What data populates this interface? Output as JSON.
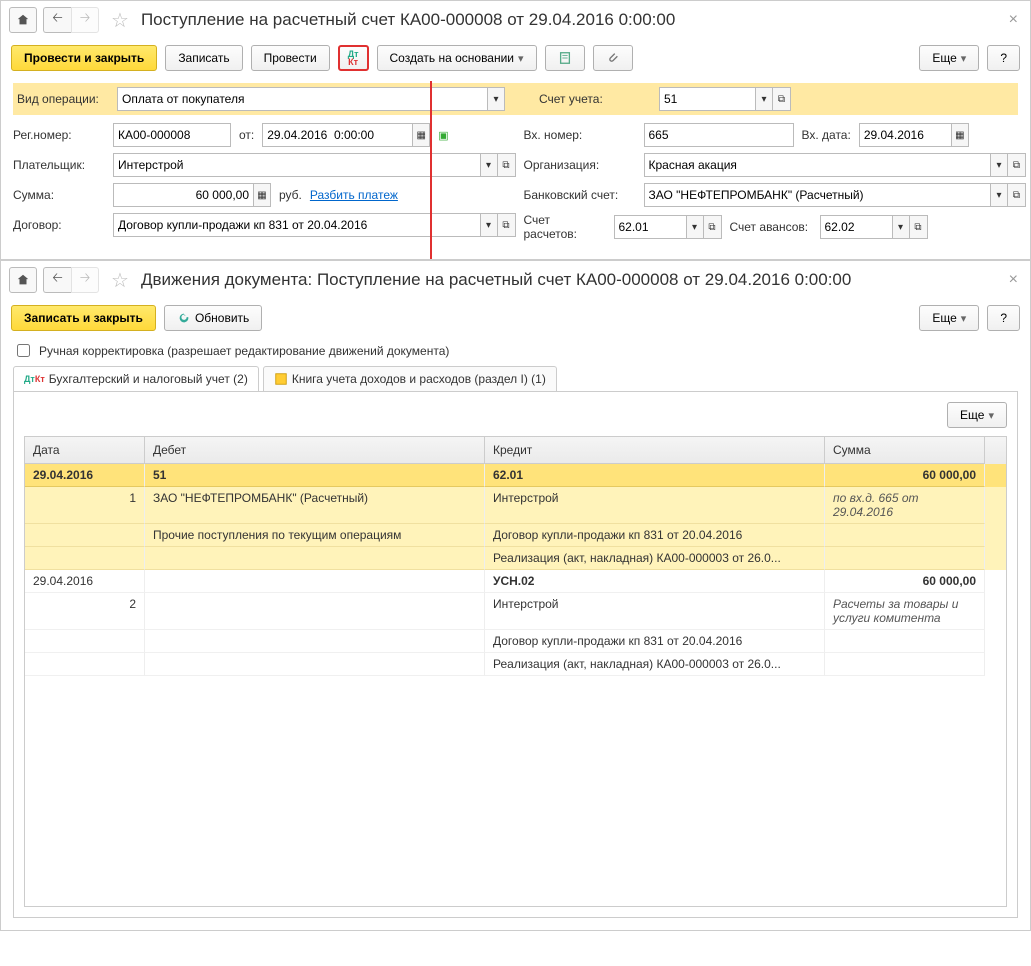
{
  "pane1": {
    "title": "Поступление на расчетный счет КА00-000008 от 29.04.2016 0:00:00",
    "toolbar": {
      "post_close": "Провести и закрыть",
      "save": "Записать",
      "post": "Провести",
      "create_based": "Создать на основании",
      "more": "Еще",
      "help": "?"
    },
    "form": {
      "op_type_label": "Вид операции:",
      "op_type_value": "Оплата от покупателя",
      "account_label": "Счет учета:",
      "account_value": "51",
      "reg_num_label": "Рег.номер:",
      "reg_num_value": "КА00-000008",
      "from_label": "от:",
      "from_value": "29.04.2016  0:00:00",
      "in_num_label": "Вх. номер:",
      "in_num_value": "665",
      "in_date_label": "Вх. дата:",
      "in_date_value": "29.04.2016",
      "payer_label": "Плательщик:",
      "payer_value": "Интерстрой",
      "org_label": "Организация:",
      "org_value": "Красная акация",
      "sum_label": "Сумма:",
      "sum_value": "60 000,00",
      "currency": "руб.",
      "split_link": "Разбить платеж",
      "bank_acc_label": "Банковский счет:",
      "bank_acc_value": "ЗАО \"НЕФТЕПРОМБАНК\" (Расчетный)",
      "contract_label": "Договор:",
      "contract_value": "Договор купли-продажи кп 831 от 20.04.2016",
      "settle_acc_label": "Счет расчетов:",
      "settle_acc_value": "62.01",
      "advance_acc_label": "Счет авансов:",
      "advance_acc_value": "62.02"
    }
  },
  "pane2": {
    "title": "Движения документа: Поступление на расчетный счет КА00-000008 от 29.04.2016 0:00:00",
    "toolbar": {
      "save_close": "Записать и закрыть",
      "refresh": "Обновить",
      "more": "Еще",
      "help": "?"
    },
    "manual_edit_label": "Ручная корректировка (разрешает редактирование движений документа)",
    "tabs": {
      "tab1": "Бухгалтерский и налоговый учет (2)",
      "tab2": "Книга учета доходов и расходов (раздел I) (1)"
    },
    "grid_more": "Еще",
    "columns": {
      "date": "Дата",
      "debit": "Дебет",
      "credit": "Кредит",
      "sum": "Сумма"
    },
    "rows": [
      {
        "date": "29.04.2016",
        "debit_acc": "51",
        "credit_acc": "62.01",
        "sum": "60 000,00",
        "n": "1",
        "debit1": "ЗАО \"НЕФТЕПРОМБАНК\" (Расчетный)",
        "credit1": "Интерстрой",
        "note": "по вх.д. 665 от 29.04.2016",
        "debit2": "Прочие поступления по текущим операциям",
        "credit2": "Договор купли-продажи кп 831 от 20.04.2016",
        "credit3": "Реализация (акт, накладная) КА00-000003 от 26.0..."
      },
      {
        "date": "29.04.2016",
        "credit_acc": "УСН.02",
        "sum": "60 000,00",
        "n": "2",
        "credit1": "Интерстрой",
        "note": "Расчеты за товары и услуги комитента",
        "credit2": "Договор купли-продажи кп 831 от 20.04.2016",
        "credit3": "Реализация (акт, накладная) КА00-000003 от 26.0..."
      }
    ]
  }
}
